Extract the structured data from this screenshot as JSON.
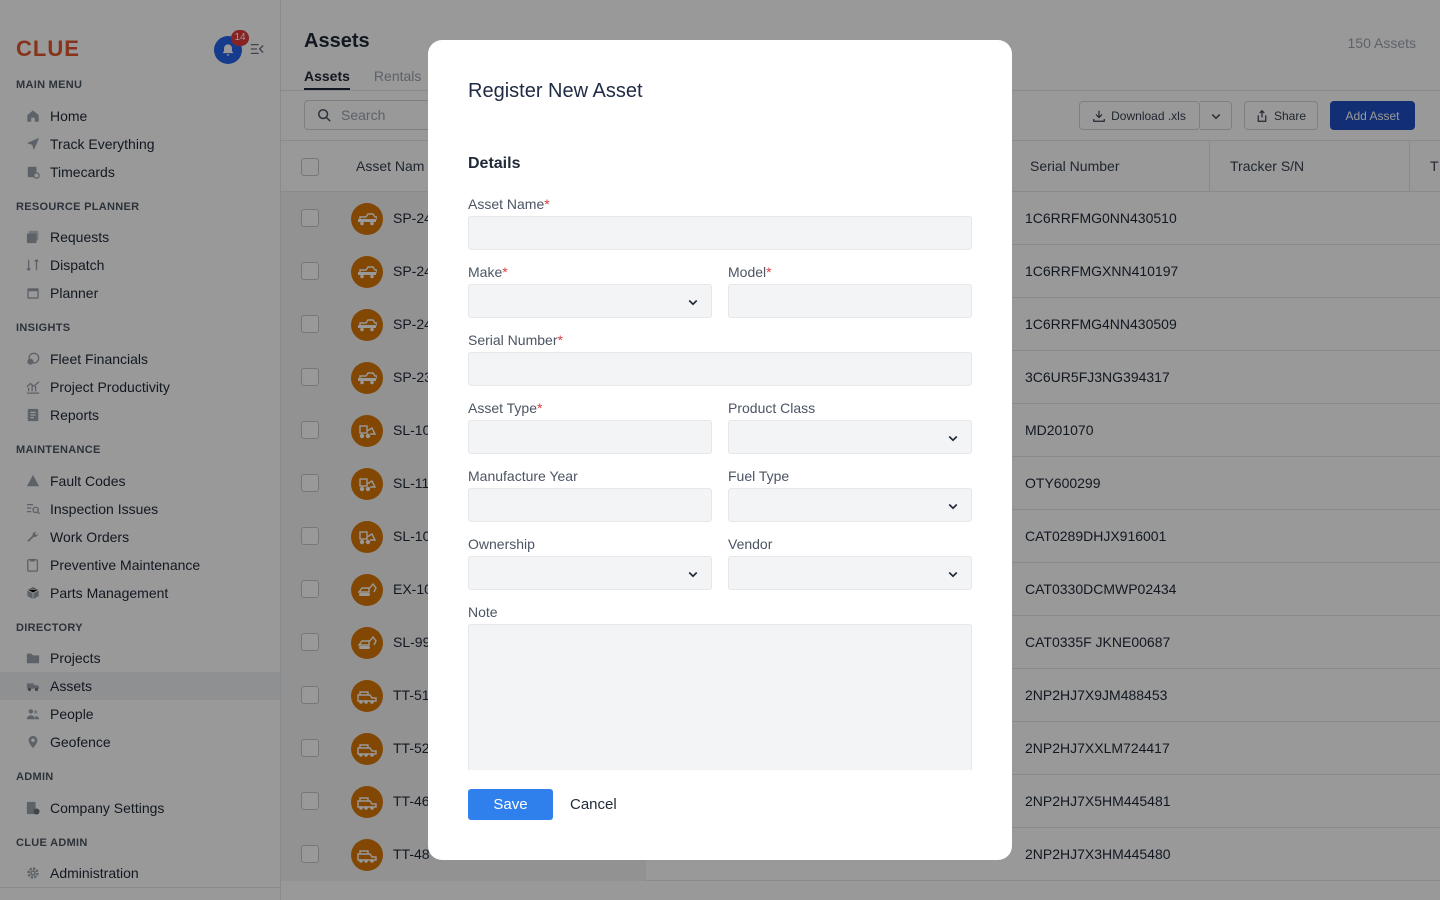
{
  "sidebar": {
    "logo": "CLUE",
    "notification_count": "14",
    "sections": [
      {
        "title": "MAIN MENU",
        "items": [
          {
            "label": "Home",
            "icon": "home-icon"
          },
          {
            "label": "Track Everything",
            "icon": "navigation-arrow-icon"
          },
          {
            "label": "Timecards",
            "icon": "timecard-icon"
          }
        ]
      },
      {
        "title": "RESOURCE PLANNER",
        "items": [
          {
            "label": "Requests",
            "icon": "requests-icon"
          },
          {
            "label": "Dispatch",
            "icon": "dispatch-icon"
          },
          {
            "label": "Planner",
            "icon": "calendar-icon"
          }
        ]
      },
      {
        "title": "INSIGHTS",
        "items": [
          {
            "label": "Fleet Financials",
            "icon": "financials-icon"
          },
          {
            "label": "Project Productivity",
            "icon": "chart-icon"
          },
          {
            "label": "Reports",
            "icon": "report-icon"
          }
        ]
      },
      {
        "title": "MAINTENANCE",
        "items": [
          {
            "label": "Fault Codes",
            "icon": "warning-triangle-icon"
          },
          {
            "label": "Inspection Issues",
            "icon": "inspection-icon"
          },
          {
            "label": "Work Orders",
            "icon": "wrench-icon"
          },
          {
            "label": "Preventive Maintenance",
            "icon": "clipboard-icon"
          },
          {
            "label": "Parts Management",
            "icon": "box-icon"
          }
        ]
      },
      {
        "title": "DIRECTORY",
        "items": [
          {
            "label": "Projects",
            "icon": "folder-icon"
          },
          {
            "label": "Assets",
            "icon": "truck-icon"
          },
          {
            "label": "People",
            "icon": "people-icon"
          },
          {
            "label": "Geofence",
            "icon": "map-pin-icon"
          }
        ]
      },
      {
        "title": "ADMIN",
        "items": [
          {
            "label": "Company Settings",
            "icon": "company-settings-icon"
          }
        ]
      },
      {
        "title": "CLUE ADMIN",
        "items": [
          {
            "label": "Administration",
            "icon": "gear-icon"
          }
        ]
      }
    ]
  },
  "main": {
    "title": "Assets",
    "count": "150 Assets",
    "tabs": [
      "Assets",
      "Rentals"
    ],
    "search_placeholder": "Search",
    "download_label": "Download .xls",
    "share_label": "Share",
    "add_label": "Add Asset",
    "columns": [
      "Asset Nam",
      "Serial Number",
      "Tracker S/N",
      "T"
    ],
    "rows": [
      {
        "name": "SP-24",
        "serial": "1C6RRFMG0NN430510",
        "type": "pickup"
      },
      {
        "name": "SP-24",
        "serial": "1C6RRFMGXNN410197",
        "type": "pickup"
      },
      {
        "name": "SP-24",
        "serial": "1C6RRFMG4NN430509",
        "type": "pickup"
      },
      {
        "name": "SP-23",
        "serial": "3C6UR5FJ3NG394317",
        "type": "pickup"
      },
      {
        "name": "SL-10",
        "serial": "MD201070",
        "type": "loader"
      },
      {
        "name": "SL-11",
        "serial": "OTY600299",
        "type": "loader"
      },
      {
        "name": "SL-10",
        "serial": "CAT0289DHJX916001",
        "type": "loader"
      },
      {
        "name": "EX-10",
        "serial": "CAT0330DCMWP02434",
        "type": "excavator"
      },
      {
        "name": "SL-99",
        "serial": "CAT0335F JKNE00687",
        "type": "excavator"
      },
      {
        "name": "TT-51",
        "serial": "2NP2HJ7X9JM488453",
        "type": "tow"
      },
      {
        "name": "TT-52",
        "serial": "2NP2HJ7XXLM724417",
        "type": "tow"
      },
      {
        "name": "TT-46",
        "serial": "2NP2HJ7X5HM445481",
        "type": "tow"
      },
      {
        "name": "TT-48",
        "serial": "2NP2HJ7X3HM445480",
        "type": "tow"
      }
    ]
  },
  "modal": {
    "title": "Register New Asset",
    "subtitle": "Details",
    "required_mark": "*",
    "fields": {
      "asset_name": "Asset Name",
      "make": "Make",
      "model": "Model",
      "serial_number": "Serial Number",
      "asset_type": "Asset Type",
      "product_class": "Product Class",
      "manufacture_year": "Manufacture Year",
      "fuel_type": "Fuel Type",
      "ownership": "Ownership",
      "vendor": "Vendor",
      "note": "Note"
    },
    "save_label": "Save",
    "cancel_label": "Cancel"
  },
  "colors": {
    "brand": "#e0582d",
    "primary": "#1e4fc4",
    "save": "#2f80ed",
    "asset_avatar": "#d97706"
  }
}
